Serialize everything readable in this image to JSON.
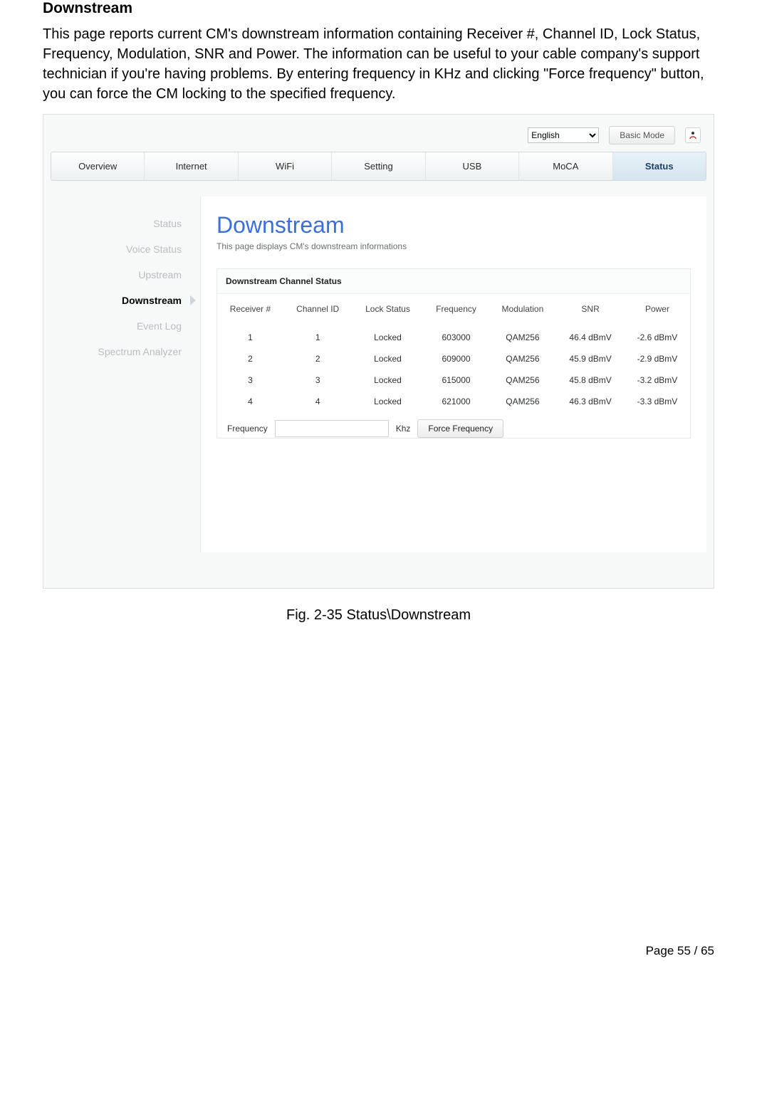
{
  "doc": {
    "heading": "Downstream",
    "paragraph": "This page reports current CM's downstream information containing Receiver #, Channel ID, Lock Status, Frequency, Modulation, SNR and Power. The information can be useful to your cable company's support technician if you're having problems. By entering frequency in KHz and clicking \"Force frequency\" button, you can force the CM locking to the specified frequency.",
    "caption": "Fig. 2-35 Status\\Downstream",
    "footer": "Page 55 / 65"
  },
  "app": {
    "topbar": {
      "language": "English",
      "mode_button": "Basic Mode"
    },
    "nav": [
      "Overview",
      "Internet",
      "WiFi",
      "Setting",
      "USB",
      "MoCA",
      "Status"
    ],
    "nav_active": "Status",
    "sidebar": [
      "Status",
      "Voice Status",
      "Upstream",
      "Downstream",
      "Event Log",
      "Spectrum Analyzer"
    ],
    "sidebar_active": "Downstream",
    "content": {
      "title": "Downstream",
      "subtitle": "This page displays CM's downstream informations",
      "panel_title": "Downstream Channel Status",
      "columns": [
        "Receiver #",
        "Channel ID",
        "Lock Status",
        "Frequency",
        "Modulation",
        "SNR",
        "Power"
      ],
      "rows": [
        [
          "1",
          "1",
          "Locked",
          "603000",
          "QAM256",
          "46.4 dBmV",
          "-2.6 dBmV"
        ],
        [
          "2",
          "2",
          "Locked",
          "609000",
          "QAM256",
          "45.9 dBmV",
          "-2.9 dBmV"
        ],
        [
          "3",
          "3",
          "Locked",
          "615000",
          "QAM256",
          "45.8 dBmV",
          "-3.2 dBmV"
        ],
        [
          "4",
          "4",
          "Locked",
          "621000",
          "QAM256",
          "46.3 dBmV",
          "-3.3 dBmV"
        ]
      ],
      "freq_label": "Frequency",
      "freq_unit": "Khz",
      "force_button": "Force Frequency"
    }
  }
}
